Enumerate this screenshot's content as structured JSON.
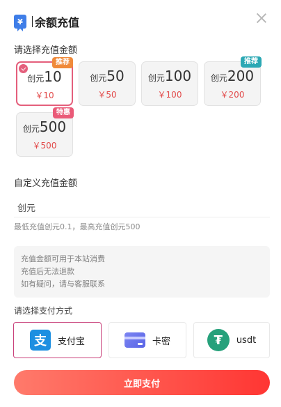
{
  "dialog": {
    "title_icon": "¥",
    "title": "余额充值",
    "close_icon": "close-icon"
  },
  "amount_section": {
    "label": "请选择充值金额",
    "options": [
      {
        "unit": "创元",
        "amount": "10",
        "price": "￥10",
        "badge": "推荐",
        "badge_color": "#f08a3a",
        "selected": true
      },
      {
        "unit": "创元",
        "amount": "50",
        "price": "￥50",
        "badge": "",
        "selected": false
      },
      {
        "unit": "创元",
        "amount": "100",
        "price": "￥100",
        "badge": "",
        "selected": false
      },
      {
        "unit": "创元",
        "amount": "200",
        "price": "￥200",
        "badge": "推荐",
        "badge_color": "#2ba8b4",
        "selected": false
      },
      {
        "unit": "创元",
        "amount": "500",
        "price": "￥500",
        "badge": "特惠",
        "badge_color": "#ea5a78",
        "selected": false
      }
    ]
  },
  "custom_section": {
    "label": "自定义充值金额",
    "placeholder": "创元",
    "hint": "最低充值创元0.1，最高充值创元500"
  },
  "notice": {
    "lines": [
      "充值金额可用于本站消费",
      "充值后无法退款",
      "如有疑问，请与客服联系"
    ]
  },
  "payment_section": {
    "label": "请选择支付方式",
    "methods": [
      {
        "label": "支付宝",
        "icon": "alipay-icon",
        "glyph": "支",
        "selected": true
      },
      {
        "label": "卡密",
        "icon": "card-icon",
        "selected": false
      },
      {
        "label": "usdt",
        "icon": "usdt-icon",
        "glyph": "₮",
        "selected": false
      }
    ]
  },
  "submit_label": "立即支付",
  "colors": {
    "accent": "#e45f7c",
    "price": "#e24a4a",
    "button_start": "#ff7a6b",
    "button_end": "#ff3633"
  }
}
